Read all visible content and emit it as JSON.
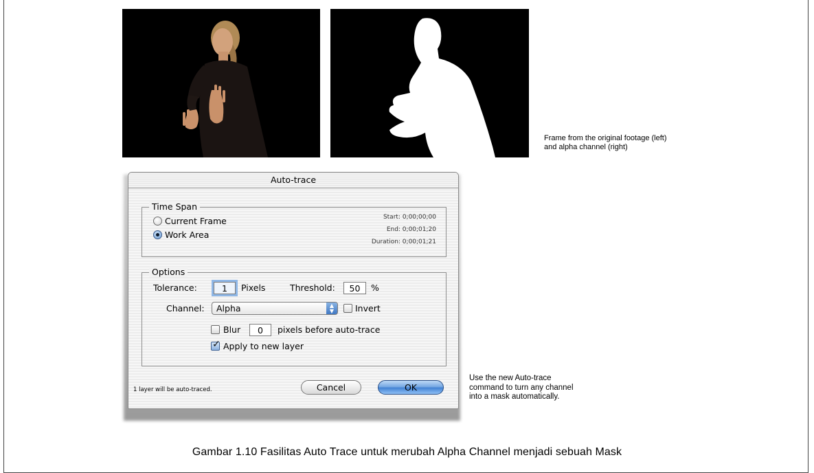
{
  "images": {
    "left_photo": "original footage frame (woman in black, hands raised)",
    "right_photo": "alpha channel matte (white silhouette on black)"
  },
  "captions": {
    "top_right_line1": "Frame from the original footage (left)",
    "top_right_line2": "and alpha channel (right)",
    "dialog_note_line1": "Use the new Auto-trace",
    "dialog_note_line2": "command to turn any channel",
    "dialog_note_line3": "into a mask automatically.",
    "figure": "Gambar 1.10 Fasilitas Auto Trace untuk merubah Alpha Channel menjadi sebuah Mask"
  },
  "dialog": {
    "title": "Auto-trace",
    "time_span": {
      "label": "Time Span",
      "current_frame": "Current Frame",
      "work_area": "Work Area",
      "selected": "work_area",
      "start": "Start:  0;00;00;00",
      "end": "End:  0;00;01;20",
      "duration": "Duration:  0;00;01;21"
    },
    "options": {
      "label": "Options",
      "tolerance_label": "Tolerance:",
      "tolerance_value": "1",
      "tolerance_unit": "Pixels",
      "threshold_label": "Threshold:",
      "threshold_value": "50",
      "threshold_unit": "%",
      "channel_label": "Channel:",
      "channel_value": "Alpha",
      "invert_label": "Invert",
      "invert_checked": false,
      "blur_label": "Blur",
      "blur_checked": false,
      "blur_value": "0",
      "blur_suffix": "pixels before auto-trace",
      "apply_label": "Apply to new layer",
      "apply_checked": true
    },
    "footer_note": "1 layer will be auto-traced.",
    "cancel_label": "Cancel",
    "ok_label": "OK"
  }
}
